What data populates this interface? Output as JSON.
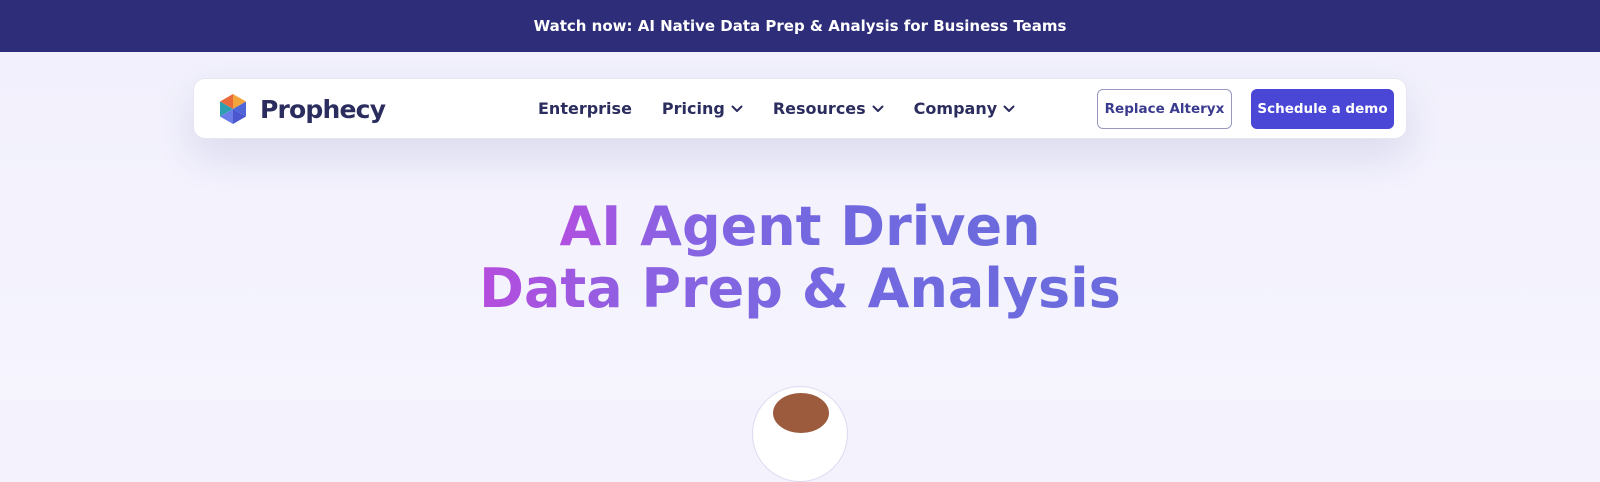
{
  "announcement": {
    "text": "Watch now: AI Native Data Prep & Analysis for Business Teams"
  },
  "brand": {
    "name": "Prophecy"
  },
  "nav": {
    "items": [
      {
        "label": "Enterprise",
        "has_dropdown": false
      },
      {
        "label": "Pricing",
        "has_dropdown": true
      },
      {
        "label": "Resources",
        "has_dropdown": true
      },
      {
        "label": "Company",
        "has_dropdown": true
      }
    ],
    "secondary_button": "Replace Alteryx",
    "primary_button": "Schedule a demo"
  },
  "hero": {
    "headline_line1": "AI Agent Driven",
    "headline_line2": "Data Prep & Analysis"
  },
  "icons": {
    "logo": "prophecy-logo-icon",
    "dropdown": "chevron-down-icon"
  },
  "colors": {
    "announcement_bg": "#2e2d79",
    "page_bg": "#f4f3fd",
    "nav_text": "#2b2d5e",
    "primary_button_bg": "#4a47d6",
    "outline_button_border": "#9797c0",
    "headline_gradient_start": "#b24fe0",
    "headline_gradient_end": "#6d6ade"
  }
}
